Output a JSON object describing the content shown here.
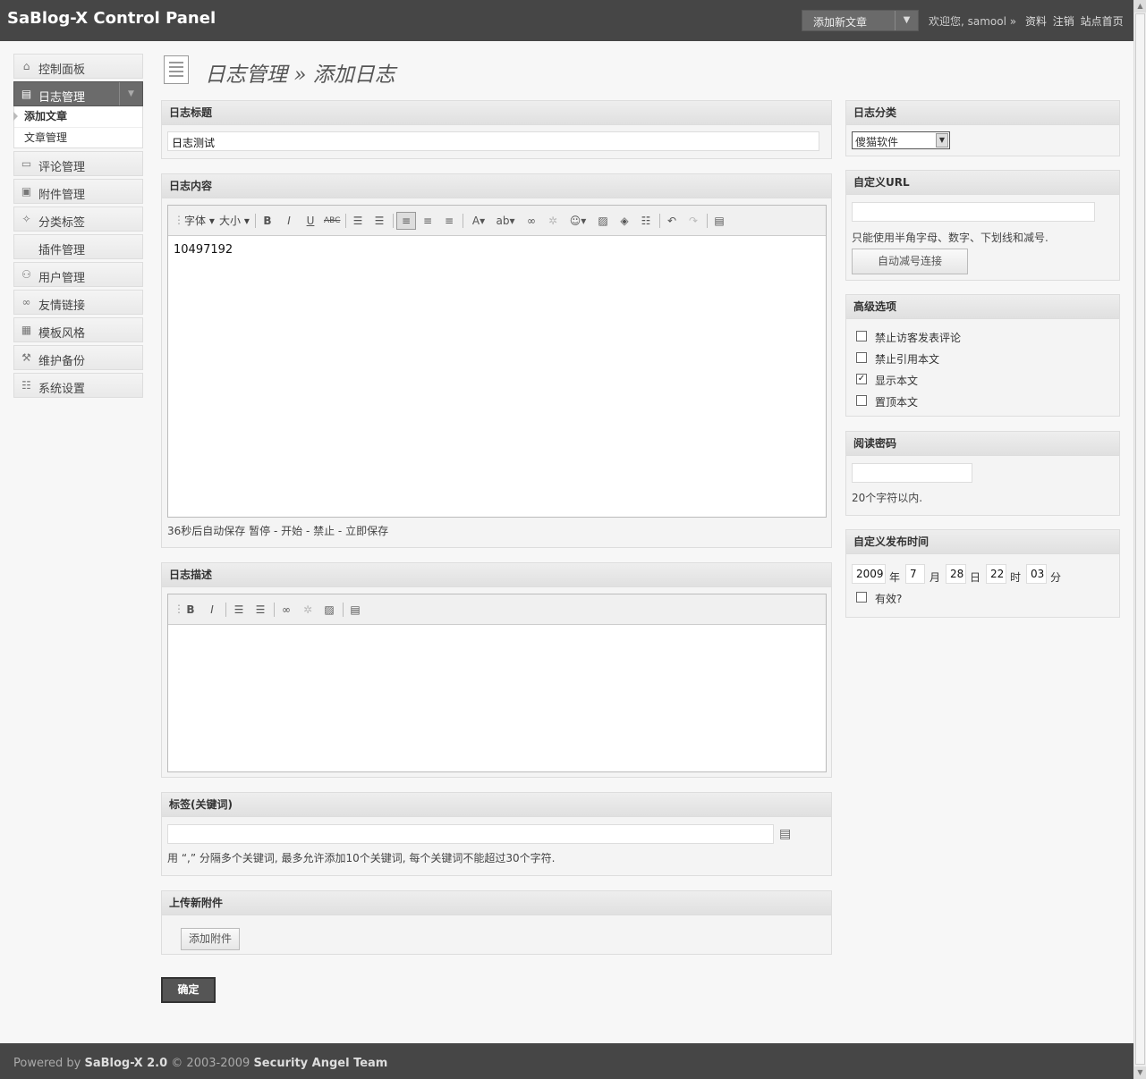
{
  "app": {
    "title": "SaBlog-X Control Panel",
    "quick_menu_label": "添加新文章",
    "welcome_text": "欢迎您, samool »",
    "links": [
      "资料",
      "注销",
      "站点首页"
    ]
  },
  "sidebar": {
    "items": [
      {
        "label": "控制面板",
        "icon": "home-icon"
      },
      {
        "label": "日志管理",
        "icon": "document-icon",
        "active": true
      },
      {
        "label": "评论管理",
        "icon": "comment-icon"
      },
      {
        "label": "附件管理",
        "icon": "attachment-icon"
      },
      {
        "label": "分类标签",
        "icon": "pin-icon"
      },
      {
        "label": "插件管理",
        "icon": ""
      },
      {
        "label": "用户管理",
        "icon": "users-icon"
      },
      {
        "label": "友情链接",
        "icon": "link-icon"
      },
      {
        "label": "模板风格",
        "icon": "template-icon"
      },
      {
        "label": "维护备份",
        "icon": "tools-icon"
      },
      {
        "label": "系统设置",
        "icon": "settings-icon"
      }
    ],
    "subitems": [
      {
        "label": "添加文章",
        "current": true
      },
      {
        "label": "文章管理"
      }
    ]
  },
  "page": {
    "breadcrumb_parent": "日志管理",
    "breadcrumb_sep": "»",
    "breadcrumb_current": "添加日志"
  },
  "title_box": {
    "header": "日志标题",
    "value": "日志测试"
  },
  "content_box": {
    "header": "日志内容",
    "toolbar_font": "字体",
    "toolbar_size": "大小",
    "body": "10497192",
    "autosave_text": "36秒后自动保存",
    "autosave_links": [
      "暂停",
      "- 开始",
      "- 禁止",
      "- 立即保存"
    ]
  },
  "desc_box": {
    "header": "日志描述"
  },
  "tags_box": {
    "header": "标签(关键词)",
    "value": "",
    "hint": "用 “,” 分隔多个关键词, 最多允许添加10个关键词, 每个关键词不能超过30个字符."
  },
  "upload_box": {
    "header": "上传新附件",
    "button": "添加附件"
  },
  "submit_label": "确定",
  "category_box": {
    "header": "日志分类",
    "selected": "傻猫软件"
  },
  "url_box": {
    "header": "自定义URL",
    "value": "",
    "hint": "只能使用半角字母、数字、下划线和减号.",
    "button": "自动减号连接"
  },
  "options_box": {
    "header": "高级选项",
    "options": [
      {
        "label": "禁止访客发表评论",
        "checked": false
      },
      {
        "label": "禁止引用本文",
        "checked": false
      },
      {
        "label": "显示本文",
        "checked": true
      },
      {
        "label": "置顶本文",
        "checked": false
      }
    ]
  },
  "password_box": {
    "header": "阅读密码",
    "value": "",
    "hint": "20个字符以内."
  },
  "time_box": {
    "header": "自定义发布时间",
    "year": "2009",
    "year_unit": "年",
    "month": "7",
    "month_unit": "月",
    "day": "28",
    "day_unit": "日",
    "hour": "22",
    "hour_unit": "时",
    "minute": "03",
    "minute_unit": "分",
    "valid_label": "有效?"
  },
  "footer": {
    "prefix": "Powered by",
    "product": "SaBlog-X 2.0",
    "copyright": "© 2003-2009",
    "team": "Security Angel Team"
  }
}
